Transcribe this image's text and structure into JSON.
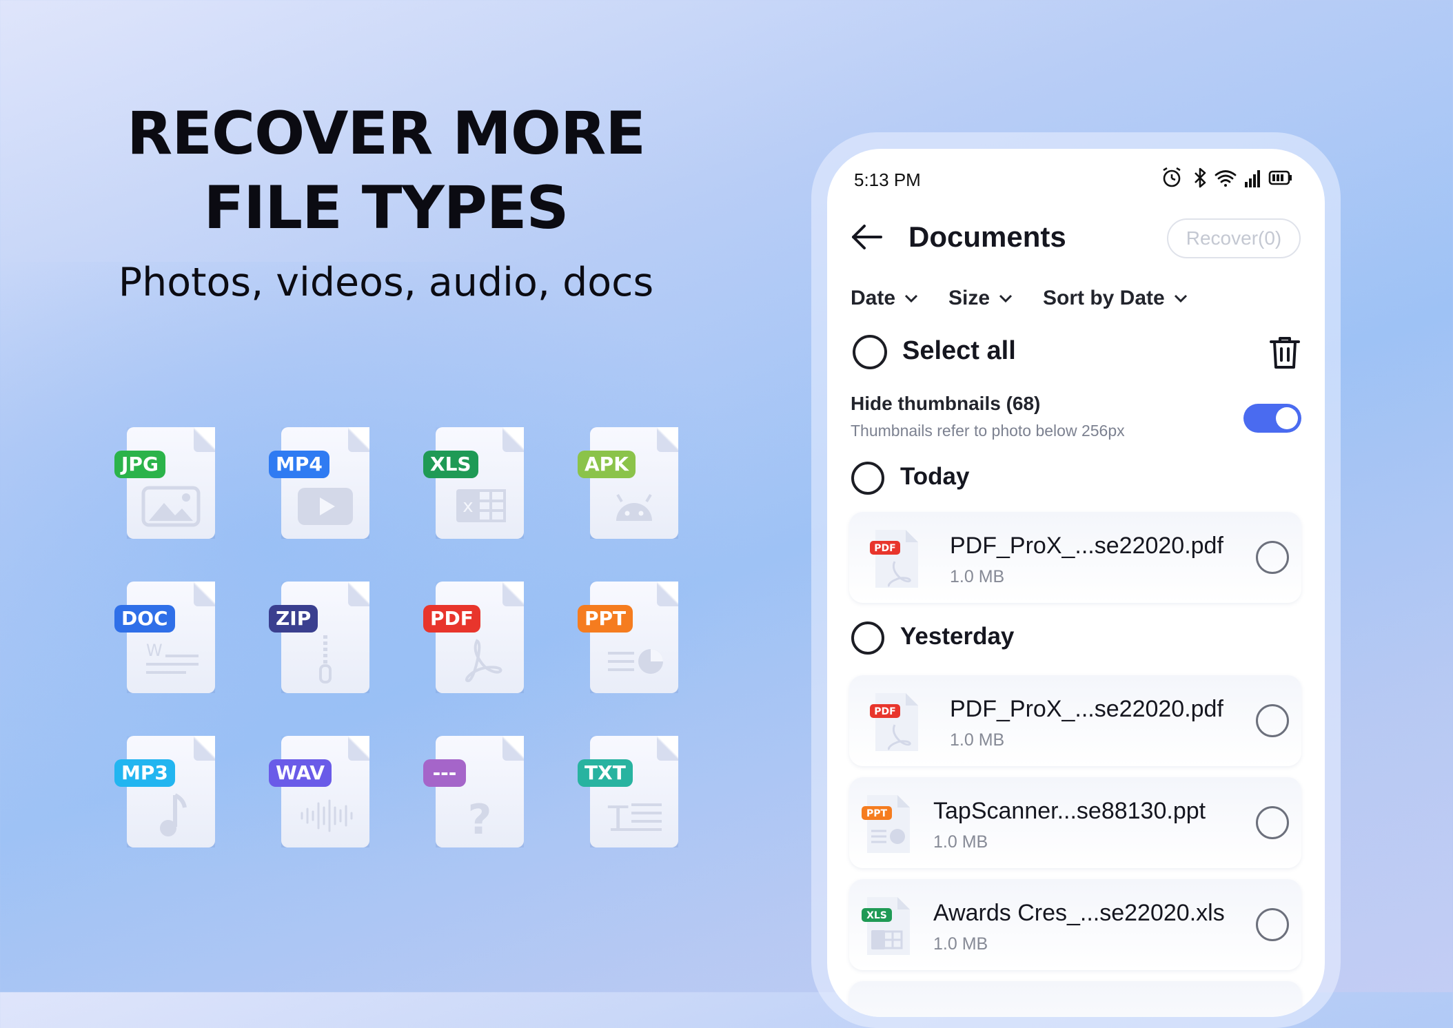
{
  "headline": {
    "line1": "RECOVER MORE",
    "line2": "FILE TYPES",
    "subtitle": "Photos, videos, audio, docs"
  },
  "file_types": [
    {
      "label": "JPG",
      "color": "#2bb34a",
      "glyph": "image-icon"
    },
    {
      "label": "MP4",
      "color": "#2f7bf2",
      "glyph": "play-icon"
    },
    {
      "label": "XLS",
      "color": "#1f9a55",
      "glyph": "spreadsheet-icon"
    },
    {
      "label": "APK",
      "color": "#8bc34a",
      "glyph": "android-icon"
    },
    {
      "label": "DOC",
      "color": "#2f6fe8",
      "glyph": "document-text-icon"
    },
    {
      "label": "ZIP",
      "color": "#3a3f8f",
      "glyph": "zipper-icon"
    },
    {
      "label": "PDF",
      "color": "#e8352c",
      "glyph": "acrobat-icon"
    },
    {
      "label": "PPT",
      "color": "#f57c1f",
      "glyph": "presentation-icon"
    },
    {
      "label": "MP3",
      "color": "#22b5f0",
      "glyph": "music-note-icon"
    },
    {
      "label": "WAV",
      "color": "#6a5be8",
      "glyph": "waveform-icon"
    },
    {
      "label": "---",
      "color": "#a565c9",
      "glyph": "question-mark-icon"
    },
    {
      "label": "TXT",
      "color": "#28b3a0",
      "glyph": "text-lines-icon"
    }
  ],
  "status_bar": {
    "time": "5:13 PM",
    "icons": [
      "alarm-icon",
      "bluetooth-icon",
      "wifi-icon",
      "signal-icon",
      "battery-icon"
    ]
  },
  "header": {
    "title": "Documents",
    "recover_label": "Recover(0)"
  },
  "filters": [
    {
      "label": "Date"
    },
    {
      "label": "Size"
    },
    {
      "label": "Sort by Date"
    }
  ],
  "select_all": {
    "label": "Select all"
  },
  "hide_thumbnails": {
    "title": "Hide thumbnails (68)",
    "subtitle": "Thumbnails refer to photo below 256px",
    "enabled": true
  },
  "sections": [
    {
      "label": "Today",
      "files": [
        {
          "name": "PDF_ProX_...se22020.pdf",
          "size": "1.0 MB",
          "type": "PDF"
        }
      ]
    },
    {
      "label": "Yesterday",
      "files": [
        {
          "name": "PDF_ProX_...se22020.pdf",
          "size": "1.0 MB",
          "type": "PDF"
        },
        {
          "name": "TapScanner...se88130.ppt",
          "size": "1.0 MB",
          "type": "PPT"
        },
        {
          "name": "Awards Cres_...se22020.xls",
          "size": "1.0 MB",
          "type": "XLS"
        }
      ]
    }
  ],
  "colors": {
    "accent": "#4a6bf0",
    "pdf": "#e8352c",
    "ppt": "#f57c1f",
    "xls": "#1f9a55"
  }
}
